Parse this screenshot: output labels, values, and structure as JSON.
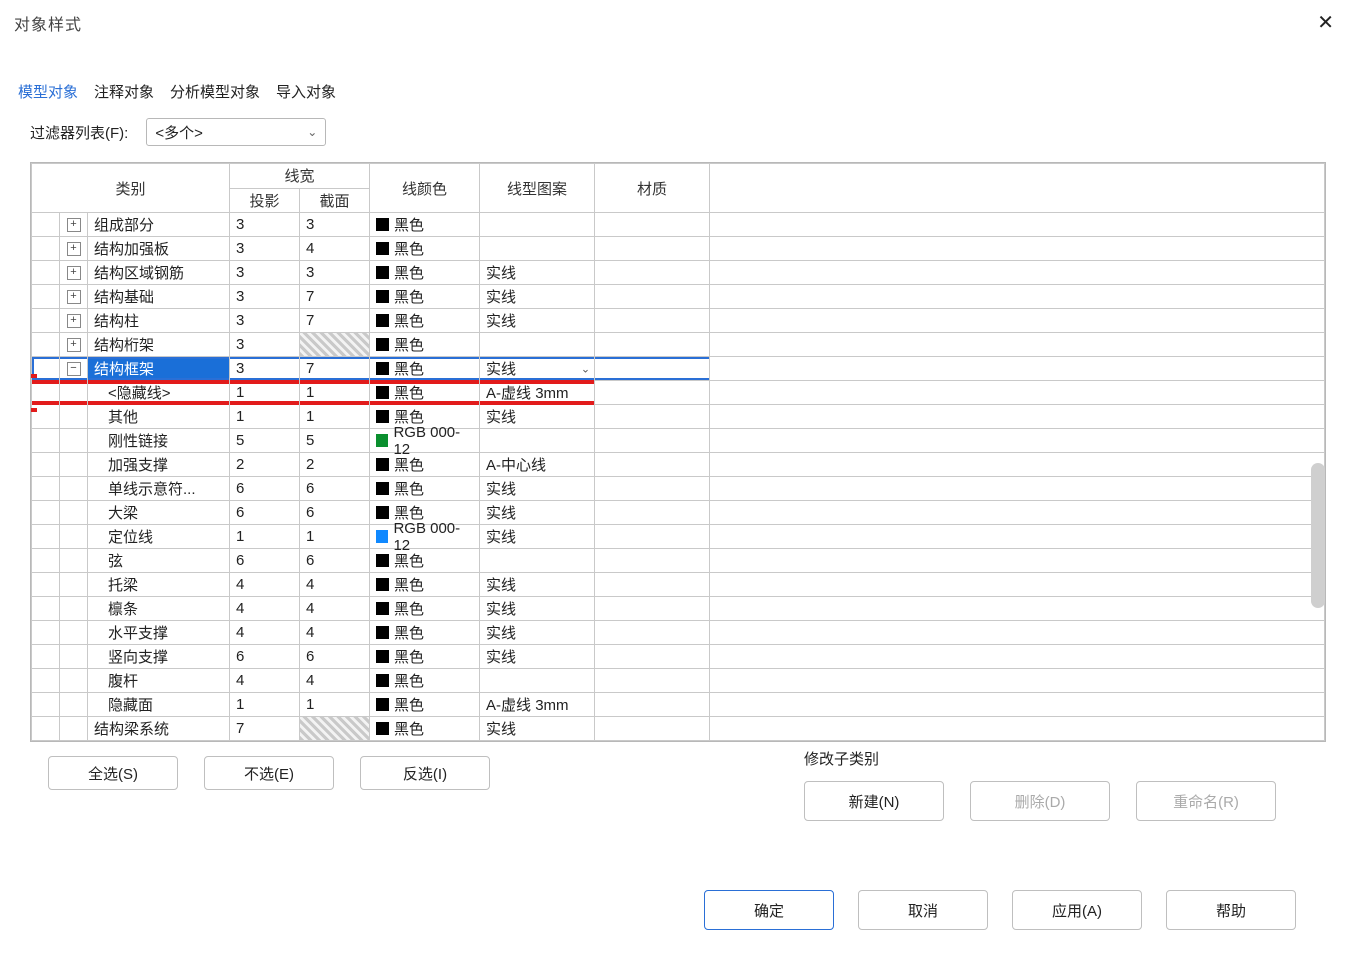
{
  "window": {
    "title": "对象样式"
  },
  "tabs": {
    "items": [
      {
        "label": "模型对象",
        "active": true
      },
      {
        "label": "注释对象"
      },
      {
        "label": "分析模型对象"
      },
      {
        "label": "导入对象"
      }
    ]
  },
  "filter": {
    "label": "过滤器列表(F):",
    "selected": "<多个>"
  },
  "grid": {
    "headers": {
      "category": "类别",
      "line_weight": "线宽",
      "projection": "投影",
      "section": "截面",
      "line_color": "线颜色",
      "line_pattern": "线型图案",
      "material": "材质"
    },
    "rows": [
      {
        "lvl": 0,
        "exp": "plus",
        "name": "组成部分",
        "proj": "3",
        "sect": "3",
        "color": "黑色",
        "sw": "black",
        "pat": "",
        "mat": ""
      },
      {
        "lvl": 0,
        "exp": "plus",
        "name": "结构加强板",
        "proj": "3",
        "sect": "4",
        "color": "黑色",
        "sw": "black",
        "pat": "",
        "mat": ""
      },
      {
        "lvl": 0,
        "exp": "plus",
        "name": "结构区域钢筋",
        "proj": "3",
        "sect": "3",
        "color": "黑色",
        "sw": "black",
        "pat": "实线",
        "mat": ""
      },
      {
        "lvl": 0,
        "exp": "plus",
        "name": "结构基础",
        "proj": "3",
        "sect": "7",
        "color": "黑色",
        "sw": "black",
        "pat": "实线",
        "mat": ""
      },
      {
        "lvl": 0,
        "exp": "plus",
        "name": "结构柱",
        "proj": "3",
        "sect": "7",
        "color": "黑色",
        "sw": "black",
        "pat": "实线",
        "mat": ""
      },
      {
        "lvl": 0,
        "exp": "plus",
        "name": "结构桁架",
        "proj": "3",
        "sect": "",
        "sect_hatch": true,
        "color": "黑色",
        "sw": "black",
        "pat": "",
        "mat": ""
      },
      {
        "lvl": 0,
        "exp": "minus",
        "name": "结构框架",
        "proj": "3",
        "sect": "7",
        "color": "黑色",
        "sw": "black",
        "pat": "实线",
        "pat_dd": true,
        "mat": "",
        "sel": true
      },
      {
        "lvl": 1,
        "exp": "",
        "name": "<隐藏线>",
        "proj": "1",
        "sect": "1",
        "color": "黑色",
        "sw": "black",
        "pat": "A-虚线 3mm",
        "mat": "",
        "red": true
      },
      {
        "lvl": 1,
        "exp": "",
        "name": "其他",
        "proj": "1",
        "sect": "1",
        "color": "黑色",
        "sw": "black",
        "pat": "实线",
        "mat": ""
      },
      {
        "lvl": 1,
        "exp": "",
        "name": "刚性链接",
        "proj": "5",
        "sect": "5",
        "color": "RGB 000-12",
        "sw": "green",
        "pat": "",
        "mat": ""
      },
      {
        "lvl": 1,
        "exp": "",
        "name": "加强支撑",
        "proj": "2",
        "sect": "2",
        "color": "黑色",
        "sw": "black",
        "pat": "A-中心线",
        "mat": ""
      },
      {
        "lvl": 1,
        "exp": "",
        "name": "单线示意符...",
        "proj": "6",
        "sect": "6",
        "color": "黑色",
        "sw": "black",
        "pat": "实线",
        "mat": ""
      },
      {
        "lvl": 1,
        "exp": "",
        "name": "大梁",
        "proj": "6",
        "sect": "6",
        "color": "黑色",
        "sw": "black",
        "pat": "实线",
        "mat": ""
      },
      {
        "lvl": 1,
        "exp": "",
        "name": "定位线",
        "proj": "1",
        "sect": "1",
        "color": "RGB 000-12",
        "sw": "blue",
        "pat": "实线",
        "mat": ""
      },
      {
        "lvl": 1,
        "exp": "",
        "name": "弦",
        "proj": "6",
        "sect": "6",
        "color": "黑色",
        "sw": "black",
        "pat": "",
        "mat": ""
      },
      {
        "lvl": 1,
        "exp": "",
        "name": "托梁",
        "proj": "4",
        "sect": "4",
        "color": "黑色",
        "sw": "black",
        "pat": "实线",
        "mat": ""
      },
      {
        "lvl": 1,
        "exp": "",
        "name": "檩条",
        "proj": "4",
        "sect": "4",
        "color": "黑色",
        "sw": "black",
        "pat": "实线",
        "mat": ""
      },
      {
        "lvl": 1,
        "exp": "",
        "name": "水平支撑",
        "proj": "4",
        "sect": "4",
        "color": "黑色",
        "sw": "black",
        "pat": "实线",
        "mat": ""
      },
      {
        "lvl": 1,
        "exp": "",
        "name": "竖向支撑",
        "proj": "6",
        "sect": "6",
        "color": "黑色",
        "sw": "black",
        "pat": "实线",
        "mat": ""
      },
      {
        "lvl": 1,
        "exp": "",
        "name": "腹杆",
        "proj": "4",
        "sect": "4",
        "color": "黑色",
        "sw": "black",
        "pat": "",
        "mat": ""
      },
      {
        "lvl": 1,
        "exp": "",
        "name": "隐藏面",
        "proj": "1",
        "sect": "1",
        "color": "黑色",
        "sw": "black",
        "pat": "A-虚线 3mm",
        "mat": ""
      },
      {
        "lvl": 0,
        "exp": "",
        "name": "结构梁系统",
        "proj": "7",
        "sect": "",
        "sect_hatch": true,
        "color": "黑色",
        "sw": "black",
        "pat": "实线",
        "mat": ""
      }
    ]
  },
  "selection_buttons": {
    "select_all": "全选(S)",
    "select_none": "不选(E)",
    "invert": "反选(I)"
  },
  "subcategory": {
    "title": "修改子类别",
    "new": "新建(N)",
    "delete": "删除(D)",
    "rename": "重命名(R)"
  },
  "dialog_buttons": {
    "ok": "确定",
    "cancel": "取消",
    "apply": "应用(A)",
    "help": "帮助"
  }
}
